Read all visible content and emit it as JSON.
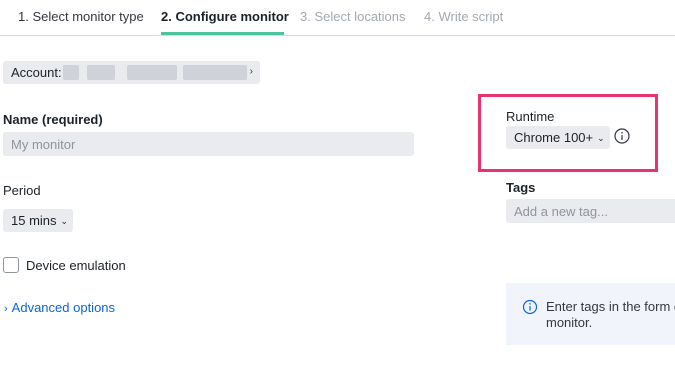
{
  "steps": [
    {
      "label": "1. Select monitor type",
      "state": "done"
    },
    {
      "label": "2. Configure monitor",
      "state": "active"
    },
    {
      "label": "3. Select locations",
      "state": "todo"
    },
    {
      "label": "4. Write script",
      "state": "todo"
    }
  ],
  "account": {
    "label": "Account:",
    "caret": "›"
  },
  "name_field": {
    "label": "Name (required)",
    "placeholder": "My monitor"
  },
  "period": {
    "label": "Period",
    "value": "15 mins"
  },
  "device_emulation": {
    "label": "Device emulation",
    "checked": false
  },
  "advanced_options": {
    "label": "Advanced options"
  },
  "runtime": {
    "label": "Runtime",
    "value": "Chrome 100+"
  },
  "tags": {
    "label": "Tags",
    "placeholder": "Add a new tag..."
  },
  "callout": {
    "line1": "Enter tags in the form o",
    "line2": "monitor."
  },
  "colors": {
    "accent": "#4cc49a",
    "highlight": "#e8336f",
    "link": "#0b64dd"
  }
}
